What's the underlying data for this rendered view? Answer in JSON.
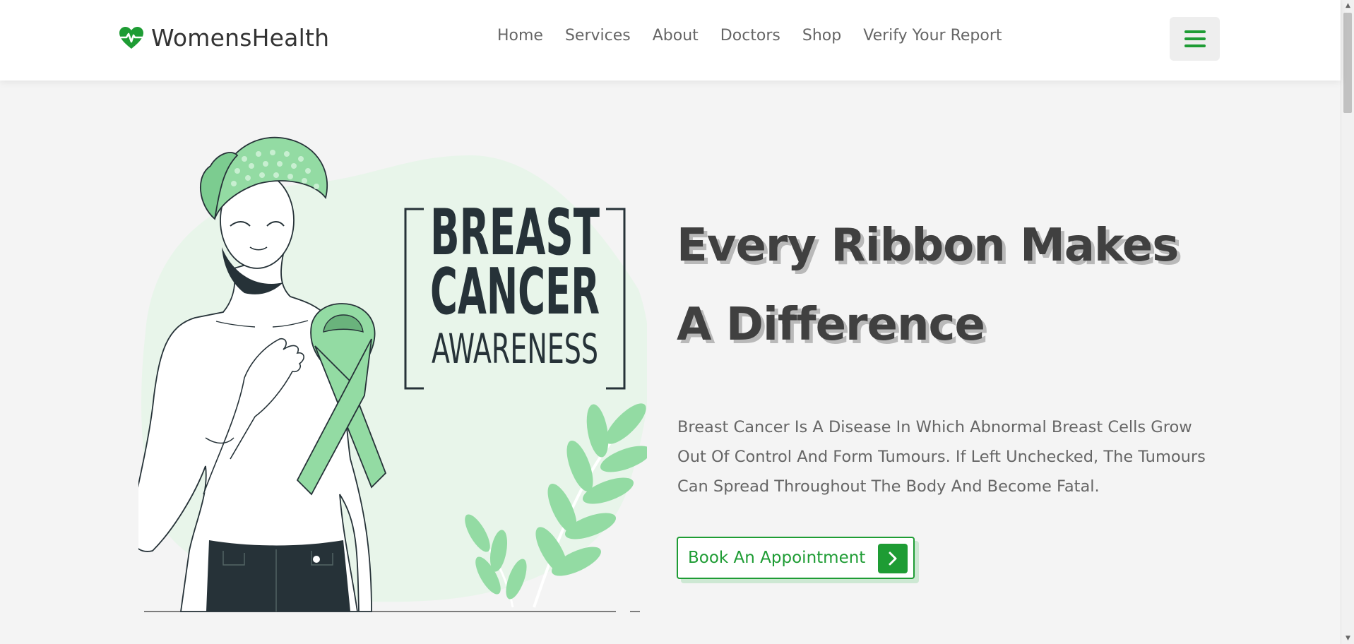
{
  "brand": {
    "name": "WomensHealth",
    "logo_icon": "heart-pulse-icon",
    "accent_color": "#1e9c34"
  },
  "nav": {
    "items": [
      {
        "label": "Home"
      },
      {
        "label": "Services"
      },
      {
        "label": "About"
      },
      {
        "label": "Doctors"
      },
      {
        "label": "Shop"
      },
      {
        "label": "Verify Your Report"
      }
    ],
    "menu_icon": "hamburger-menu-icon"
  },
  "hero": {
    "illustration": {
      "sign_line1": "BREAST",
      "sign_line2": "CANCER",
      "sign_line3": "AWARENESS"
    },
    "title": "Every Ribbon Makes A Difference",
    "description": "Breast Cancer Is A Disease In Which Abnormal Breast Cells Grow Out Of Control And Form Tumours. If Left Unchecked, The Tumours Can Spread Throughout The Body And Become Fatal.",
    "cta_label": "Book An Appointment",
    "cta_icon": "chevron-right-icon"
  }
}
